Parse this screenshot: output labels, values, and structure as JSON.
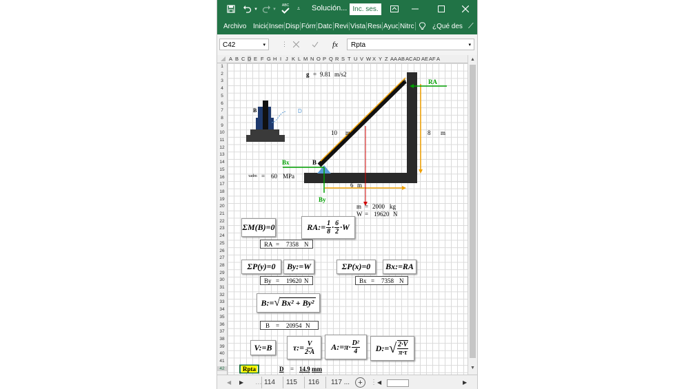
{
  "window": {
    "file_name": "Solución...",
    "sign_in": "Inc. ses.",
    "abc": "ABC"
  },
  "ribbon": {
    "tabs": [
      "Archivo",
      "Inicio",
      "Inser",
      "Disp",
      "Fórm",
      "Datc",
      "Revi:",
      "Vista",
      "Resu",
      "Ayuc",
      "Nitrc"
    ],
    "tell_me": "¿Qué des"
  },
  "formula_bar": {
    "name_box": "C42",
    "fx": "fx",
    "content": "Rpta"
  },
  "columns": [
    "A",
    "B",
    "C",
    "D",
    "E",
    "F",
    "G",
    "H",
    "I",
    "J",
    "K",
    "L",
    "M",
    "N",
    "O",
    "P",
    "Q",
    "R",
    "S",
    "T",
    "U",
    "V",
    "W",
    "X",
    "Y",
    "Z",
    "AA",
    "AB",
    "AC",
    "AD",
    "AE",
    "AF",
    "A"
  ],
  "rows": [
    "1",
    "2",
    "3",
    "4",
    "5",
    "6",
    "7",
    "8",
    "9",
    "10",
    "11",
    "12",
    "13",
    "14",
    "15",
    "16",
    "17",
    "18",
    "19",
    "20",
    "21",
    "22",
    "23",
    "24",
    "25",
    "26",
    "27",
    "28",
    "29",
    "30",
    "31",
    "32",
    "33",
    "34",
    "35",
    "36",
    "37",
    "38",
    "39",
    "40",
    "41",
    "42"
  ],
  "diagram": {
    "g_label": "g",
    "g_value": "9.81",
    "g_unit": "m/s2",
    "eq": "=",
    "ra_label": "RA",
    "b_label": "B",
    "bx_label": "Bx",
    "by_label": "By",
    "a_label": "A",
    "d_label": "D",
    "b_small": "B",
    "len_diag": "10",
    "len_diag_unit": "m",
    "len_vert": "8",
    "len_vert_unit": "m",
    "len_horiz": "6",
    "len_horiz_unit": "m",
    "tau_label": "τadm",
    "tau_value": "60",
    "tau_unit": "MPa",
    "m_label": "m",
    "m_value": "2000",
    "m_unit": "kg",
    "w_label": "W",
    "w_value": "19620",
    "w_unit": "N"
  },
  "equations": {
    "sum_m": "ΣM(B)=0",
    "ra_eq_lhs": "RA:=",
    "ra_eq_f1_num": "1",
    "ra_eq_f1_den": "8",
    "ra_eq_dot": "·",
    "ra_eq_f2_num": "6",
    "ra_eq_f2_den": "2",
    "ra_eq_rhs": "·W",
    "sum_py": "ΣP(y)=0",
    "by_eq": "By:=W",
    "sum_px": "ΣP(x)=0",
    "bx_eq": "Bx:=RA",
    "b_eq_lhs": "B:=",
    "b_eq_rad": "Bx² + By²",
    "v_eq": "V:=B",
    "tau_lhs": "τ:=",
    "tau_num": "V",
    "tau_den": "2·A",
    "a_lhs": "A:=π·",
    "a_num": "D²",
    "a_den": "4",
    "d_lhs": "D:=",
    "d_num": "2·V",
    "d_den": "π·τ"
  },
  "results": {
    "ra_label": "RA",
    "ra_value": "7358",
    "ra_unit": "N",
    "by_label": "By",
    "by_value": "19620",
    "by_unit": "N",
    "bx_label": "Bx",
    "bx_value": "7358",
    "bx_unit": "N",
    "b_label": "B",
    "b_value": "20954",
    "b_unit": "N",
    "rpta": "Rpta",
    "d_label": "D",
    "d_value": "14.9",
    "d_unit": "mm"
  },
  "sheets": [
    "114",
    "115",
    "116",
    "117 ..."
  ],
  "colors": {
    "title_green": "#217346",
    "force_green": "#00a000",
    "dim_orange": "#f0a000",
    "weight_red": "#d00000",
    "beam": "#2a2a2a",
    "highlight": "#ffff00",
    "support_blue": "#5a9bd5"
  }
}
